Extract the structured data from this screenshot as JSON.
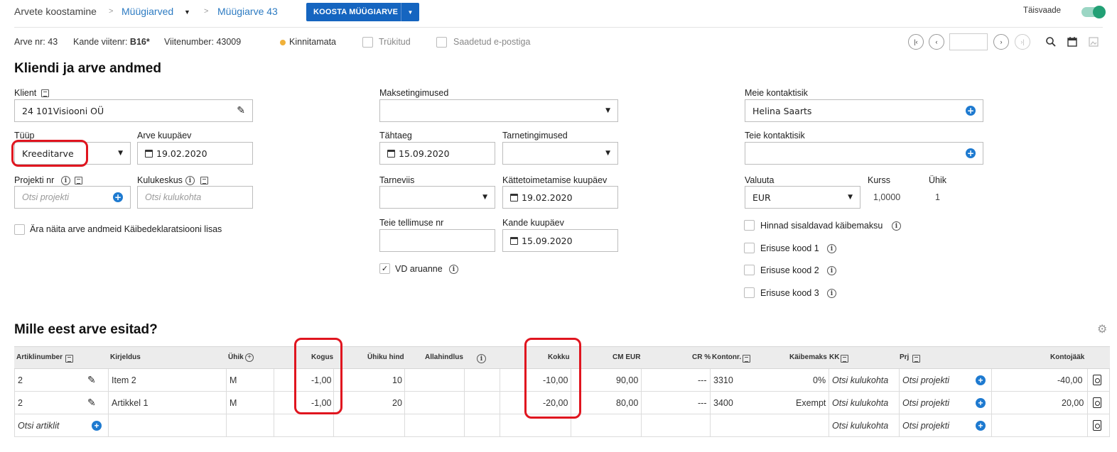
{
  "breadcrumb": {
    "root": "Arvete koostamine",
    "sep": ">",
    "level1": "Müügiarved",
    "level2": "Müügiarve 43"
  },
  "toolbar": {
    "primary_button": "KOOSTA MÜÜGIARVE",
    "fullscreen_label": "Täisvaade",
    "fullscreen_on": true
  },
  "meta": {
    "invoice_no_label": "Arve nr:",
    "invoice_no": "43",
    "entry_ref_label": "Kande viitenr:",
    "entry_ref": "B16*",
    "ref_no_label": "Viitenumber:",
    "ref_no": "43009",
    "status": "Kinnitamata",
    "printed": "Trükitud",
    "emailed": "Saadetud e-postiga"
  },
  "section1": {
    "title": "Kliendi ja arve andmed",
    "client_label": "Klient",
    "client_value": "24 101Visiooni OÜ",
    "type_label": "Tüüp",
    "type_value": "Kreeditarve",
    "invoice_date_label": "Arve kuupäev",
    "invoice_date": "19.02.2020",
    "project_label": "Projekti nr",
    "project_placeholder": "Otsi projekti",
    "cost_center_label": "Kulukeskus",
    "cost_center_placeholder": "Otsi kulukohta",
    "hide_vat_label": "Ära näita arve andmeid Käibedeklaratsiooni lisas",
    "payment_terms_label": "Maksetingimused",
    "payment_terms_value": "",
    "due_label": "Tähtaeg",
    "due_date": "15.09.2020",
    "delivery_terms_label": "Tarnetingimused",
    "delivery_method_label": "Tarneviis",
    "delivery_date_label": "Kättetoimetamise kuupäev",
    "delivery_date": "19.02.2020",
    "your_order_label": "Teie tellimuse nr",
    "entry_date_label": "Kande kuupäev",
    "entry_date": "15.09.2020",
    "vd_report_label": "VD aruanne",
    "vd_report_checked": true,
    "our_contact_label": "Meie kontaktisik",
    "our_contact_value": "Helina Saarts",
    "your_contact_label": "Teie kontaktisik",
    "currency_label": "Valuuta",
    "currency_value": "EUR",
    "rate_label": "Kurss",
    "rate_value": "1,0000",
    "unit_label": "Ühik",
    "unit_value": "1",
    "prices_incl_vat_label": "Hinnad sisaldavad käibemaksu",
    "special_code1": "Erisuse kood 1",
    "special_code2": "Erisuse kood 2",
    "special_code3": "Erisuse kood 3"
  },
  "section2": {
    "title": "Mille eest arve esitad?",
    "headers": {
      "article": "Artiklinumber",
      "description": "Kirjeldus",
      "unit": "Ühik",
      "qty": "Kogus",
      "unit_price": "Ühiku hind",
      "discount": "Allahindlus",
      "total": "Kokku",
      "cm_eur": "CM EUR",
      "cr_pct": "CR %",
      "account": "Kontonr.",
      "vat": "Käibemaks",
      "kk": "KK",
      "prj": "Prj",
      "balance": "Kontojääk"
    },
    "rows": [
      {
        "article": "2",
        "description": "Item 2",
        "unit": "M",
        "qty": "-1,00",
        "unit_price": "10",
        "total": "-10,00",
        "cm_eur": "90,00",
        "cr_pct": "---",
        "account": "3310",
        "vat": "0%",
        "kk": "Otsi kulukohta",
        "prj": "Otsi projekti",
        "balance": "-40,00"
      },
      {
        "article": "2",
        "description": "Artikkel 1",
        "unit": "M",
        "qty": "-1,00",
        "unit_price": "20",
        "total": "-20,00",
        "cm_eur": "80,00",
        "cr_pct": "---",
        "account": "3400",
        "vat": "Exempt",
        "kk": "Otsi kulukohta",
        "prj": "Otsi projekti",
        "balance": "20,00"
      }
    ],
    "new_row": {
      "article_placeholder": "Otsi artiklit",
      "kk": "Otsi kulukohta",
      "prj": "Otsi projekti"
    }
  },
  "colors": {
    "link": "#2d7bc2",
    "primary": "#1565c0",
    "toggle": "#22a075",
    "status_dot": "#f0b13a",
    "highlight": "#e0151f"
  }
}
